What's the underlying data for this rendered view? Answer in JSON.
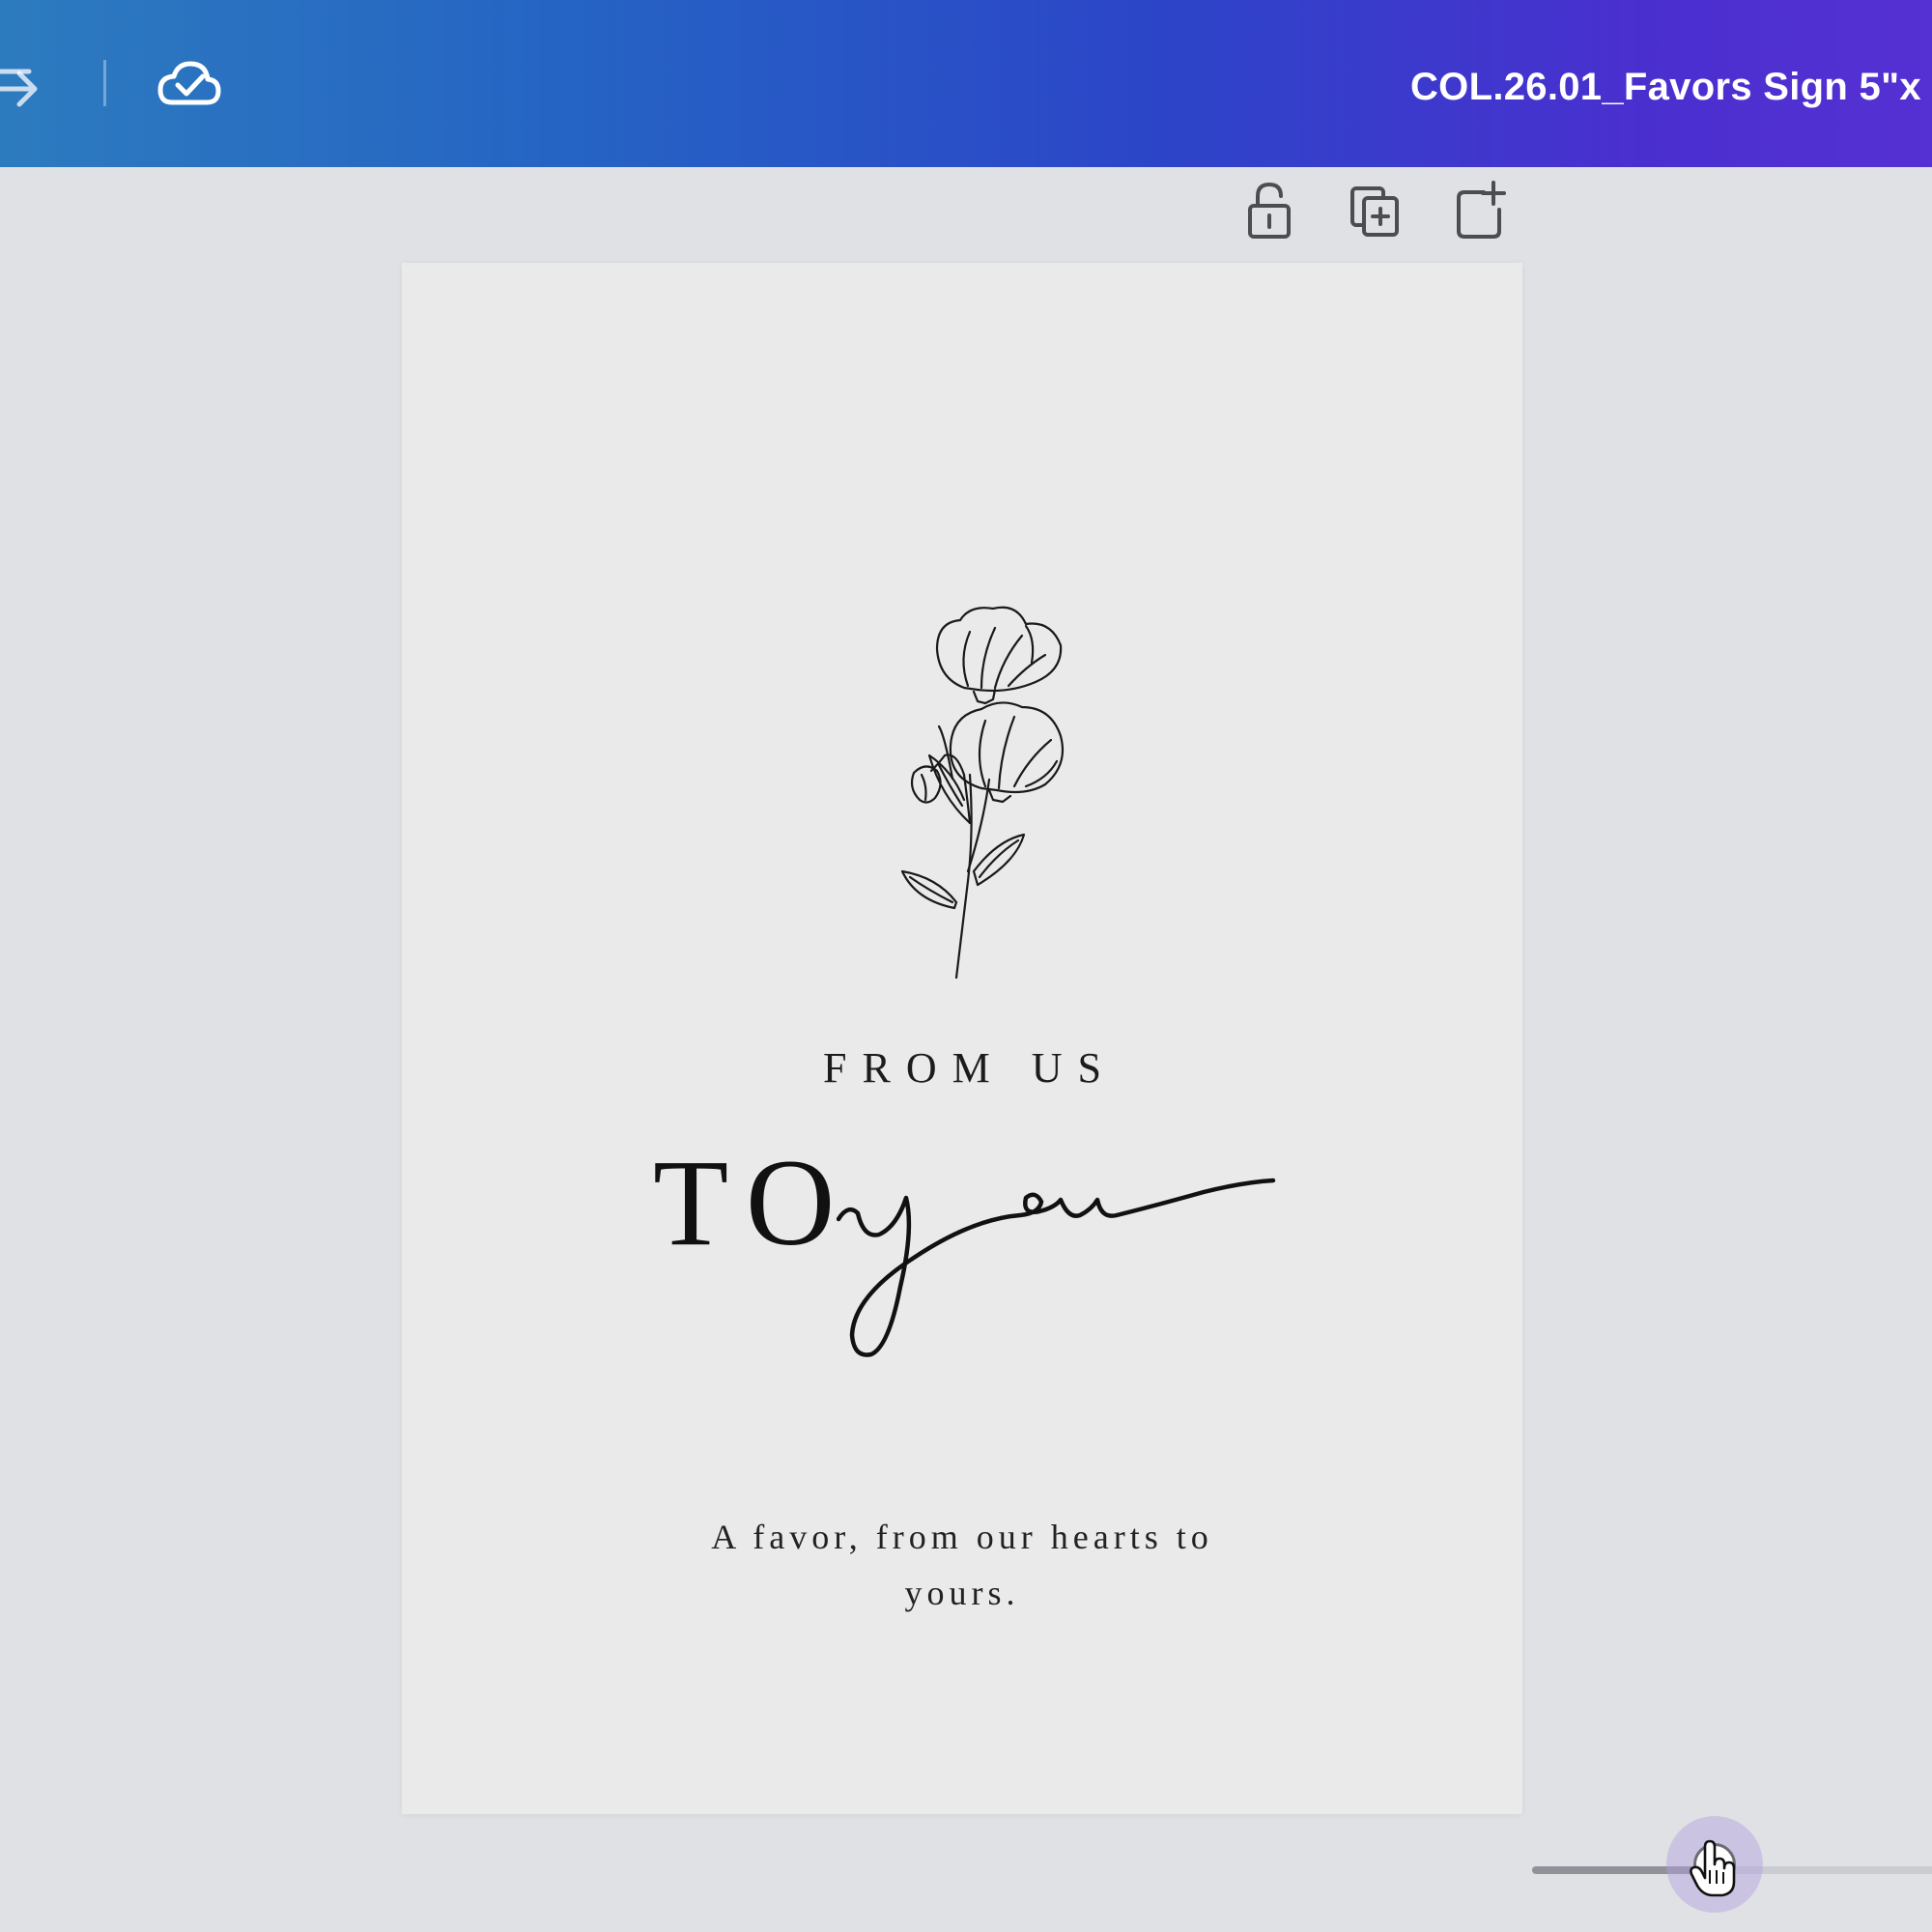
{
  "header": {
    "document_title": "COL.26.01_Favors Sign 5\"x",
    "redo_icon": "redo-icon",
    "save_status_icon": "cloud-check-icon"
  },
  "page_toolbar": {
    "lock_icon": "unlock-icon",
    "duplicate_icon": "duplicate-page-icon",
    "add_page_icon": "add-page-icon"
  },
  "design": {
    "illustration": "poppy-flower-line-art",
    "heading_small": "FROM US",
    "heading_large_serif": "TO",
    "heading_large_script": "you",
    "tagline_line1": "A favor, from our hearts to",
    "tagline_line2": "yours."
  },
  "zoom_slider": {
    "value_fraction": 0.45
  },
  "colors": {
    "header_gradient_start": "#2d7bbf",
    "header_gradient_end": "#5530d2",
    "workspace_bg": "#dfe1e4",
    "page_bg": "#eaeaea",
    "ink": "#111111"
  }
}
